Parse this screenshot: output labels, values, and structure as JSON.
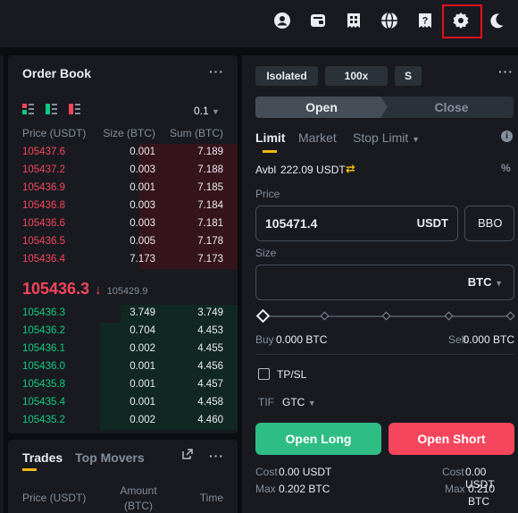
{
  "topbar": {
    "icons": [
      "user-icon",
      "wallet-icon",
      "orders-icon",
      "globe-icon",
      "help-icon",
      "settings-icon",
      "moon-icon"
    ]
  },
  "orderbook": {
    "title": "Order Book",
    "menu": "···",
    "precision": "0.1",
    "headers": {
      "price": "Price (USDT)",
      "size": "Size (BTC)",
      "sum": "Sum (BTC)"
    },
    "asks": [
      {
        "price": "105437.6",
        "size": "0.001",
        "sum": "7.189",
        "depth": 0.43
      },
      {
        "price": "105437.2",
        "size": "0.003",
        "sum": "7.188",
        "depth": 0.43
      },
      {
        "price": "105436.9",
        "size": "0.001",
        "sum": "7.185",
        "depth": 0.43
      },
      {
        "price": "105436.8",
        "size": "0.003",
        "sum": "7.184",
        "depth": 0.43
      },
      {
        "price": "105436.6",
        "size": "0.003",
        "sum": "7.181",
        "depth": 0.43
      },
      {
        "price": "105436.5",
        "size": "0.005",
        "sum": "7.178",
        "depth": 0.43
      },
      {
        "price": "105436.4",
        "size": "7.173",
        "sum": "7.173",
        "depth": 0.43
      }
    ],
    "mid": {
      "price": "105436.3",
      "arrow": "↓",
      "mark": "105429.9"
    },
    "bids": [
      {
        "price": "105436.3",
        "size": "3.749",
        "sum": "3.749",
        "depth": 0.51
      },
      {
        "price": "105436.2",
        "size": "0.704",
        "sum": "4.453",
        "depth": 0.6
      },
      {
        "price": "105436.1",
        "size": "0.002",
        "sum": "4.455",
        "depth": 0.6
      },
      {
        "price": "105436.0",
        "size": "0.001",
        "sum": "4.456",
        "depth": 0.6
      },
      {
        "price": "105435.8",
        "size": "0.001",
        "sum": "4.457",
        "depth": 0.6
      },
      {
        "price": "105435.4",
        "size": "0.001",
        "sum": "4.458",
        "depth": 0.6
      },
      {
        "price": "105435.2",
        "size": "0.002",
        "sum": "4.460",
        "depth": 0.6
      }
    ]
  },
  "trades": {
    "tabs": [
      "Trades",
      "Top Movers"
    ],
    "menu": "···",
    "headers": {
      "price": "Price (USDT)",
      "amount": "Amount\n(BTC)",
      "time": "Time"
    }
  },
  "form": {
    "margin_mode": "Isolated",
    "leverage": "100x",
    "asset_mode": "S",
    "menu": "···",
    "open_tab": "Open",
    "close_tab": "Close",
    "order_types": [
      "Limit",
      "Market",
      "Stop Limit"
    ],
    "avbl_label": "Avbl",
    "avbl_value": "222.09 USDT",
    "price_label": "Price",
    "price_value": "105471.4",
    "price_unit": "USDT",
    "bbo": "BBO",
    "size_label": "Size",
    "size_value": "",
    "size_unit": "BTC",
    "buy_label": "Buy",
    "buy_value": "0.000 BTC",
    "sell_label": "Sell",
    "sell_value": "0.000 BTC",
    "tpsl_label": "TP/SL",
    "tif_label": "TIF",
    "tif_value": "GTC",
    "open_long": "Open Long",
    "open_short": "Open Short",
    "cost_label": "Cost",
    "cost_long": "0.00 USDT",
    "cost_short": "0.00 USDT",
    "max_label": "Max",
    "max_long": "0.202 BTC",
    "max_short": "0.210 BTC",
    "slider_pct": 0
  },
  "colors": {
    "bid": "#0ecb81",
    "ask": "#f6465d",
    "accent": "#f0b90b",
    "highlight": "#e8101c"
  }
}
